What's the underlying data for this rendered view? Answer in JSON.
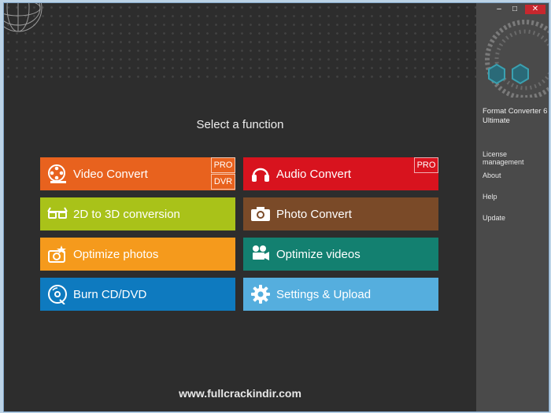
{
  "main": {
    "title": "Select a function"
  },
  "tiles": [
    {
      "label": "Video Convert",
      "icon": "film-reel-icon",
      "color": "#e8621e",
      "badges": [
        "PRO",
        "DVR"
      ]
    },
    {
      "label": "Audio Convert",
      "icon": "headphones-icon",
      "color": "#d8131e",
      "badges": [
        "PRO"
      ]
    },
    {
      "label": "2D to 3D conversion",
      "icon": "3d-glasses-icon",
      "color": "#a9c219",
      "badges": []
    },
    {
      "label": "Photo Convert",
      "icon": "camera-icon",
      "color": "#7a4a28",
      "badges": []
    },
    {
      "label": "Optimize photos",
      "icon": "camera-star-icon",
      "color": "#f59a1c",
      "badges": []
    },
    {
      "label": "Optimize videos",
      "icon": "video-camera-icon",
      "color": "#138070",
      "badges": []
    },
    {
      "label": "Burn CD/DVD",
      "icon": "disc-icon",
      "color": "#0e7abf",
      "badges": []
    },
    {
      "label": "Settings & Upload",
      "icon": "gear-icon",
      "color": "#55aede",
      "badges": []
    }
  ],
  "sidebar": {
    "app_name": "Format Converter 6 Ultimate",
    "links": [
      "License management",
      "About",
      "Help",
      "Update"
    ]
  },
  "window_controls": {
    "minimize": "–",
    "maximize": "□",
    "close": "✕"
  },
  "watermark": "www.fullcrackindir.com"
}
